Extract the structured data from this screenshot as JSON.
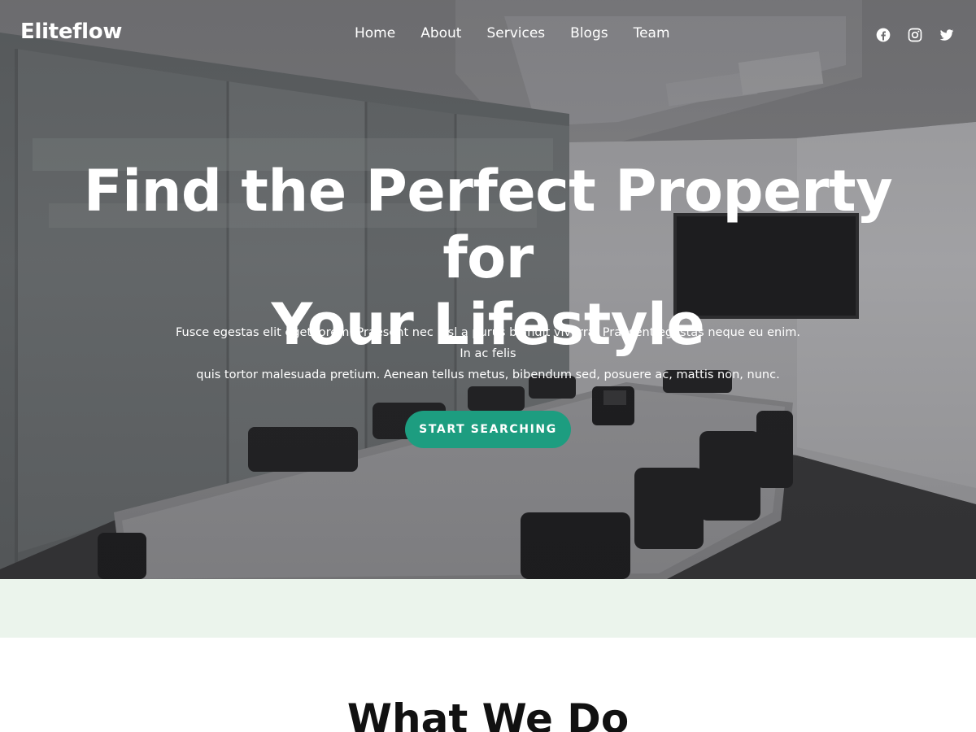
{
  "brand": {
    "name": "Eliteflow"
  },
  "nav": {
    "items": [
      {
        "label": "Home"
      },
      {
        "label": "About"
      },
      {
        "label": "Services"
      },
      {
        "label": "Blogs"
      },
      {
        "label": "Team"
      }
    ],
    "social": [
      {
        "icon": "facebook-icon"
      },
      {
        "icon": "instagram-icon"
      },
      {
        "icon": "twitter-icon"
      }
    ]
  },
  "hero": {
    "title_line1": "Find the Perfect Property for",
    "title_line2": "Your Lifestyle",
    "subtitle_line1": "Fusce egestas elit eget lorem. Praesent nec nisl a purus blandit viverra. Praesent egestas neque eu enim. In ac felis",
    "subtitle_line2": "quis tortor malesuada pretium. Aenean tellus metus, bibendum sed, posuere ac, mattis non, nunc.",
    "cta_label": "START SEARCHING"
  },
  "section": {
    "title": "What We Do"
  },
  "colors": {
    "accent": "#1d9d80",
    "strip": "#ebf4ec",
    "text_dark": "#111111",
    "text_light": "#ffffff"
  }
}
